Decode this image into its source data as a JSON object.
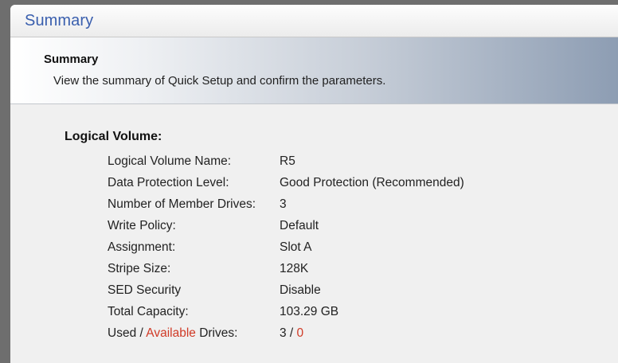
{
  "window": {
    "title": "Summary"
  },
  "header": {
    "section_title": "Summary",
    "description": "View the summary of Quick Setup and confirm the parameters."
  },
  "logical_volume": {
    "title": "Logical Volume:",
    "rows": [
      {
        "label": "Logical Volume Name:",
        "value": "R5"
      },
      {
        "label": "Data Protection Level:",
        "value": "Good Protection (Recommended)"
      },
      {
        "label": "Number of Member Drives:",
        "value": "3"
      },
      {
        "label": "Write Policy:",
        "value": "Default"
      },
      {
        "label": "Assignment:",
        "value": "Slot A"
      },
      {
        "label": "Stripe Size:",
        "value": "128K"
      },
      {
        "label": "SED Security",
        "value": "Disable"
      },
      {
        "label": "Total Capacity:",
        "value": "103.29 GB"
      }
    ],
    "drives": {
      "label_used": "Used",
      "label_sep": " / ",
      "label_available": "Available",
      "label_suffix": " Drives:",
      "used_value": "3",
      "value_sep": " / ",
      "available_value": "0"
    }
  },
  "colors": {
    "title_blue": "#3a5fae",
    "alert_red": "#d03a26"
  }
}
